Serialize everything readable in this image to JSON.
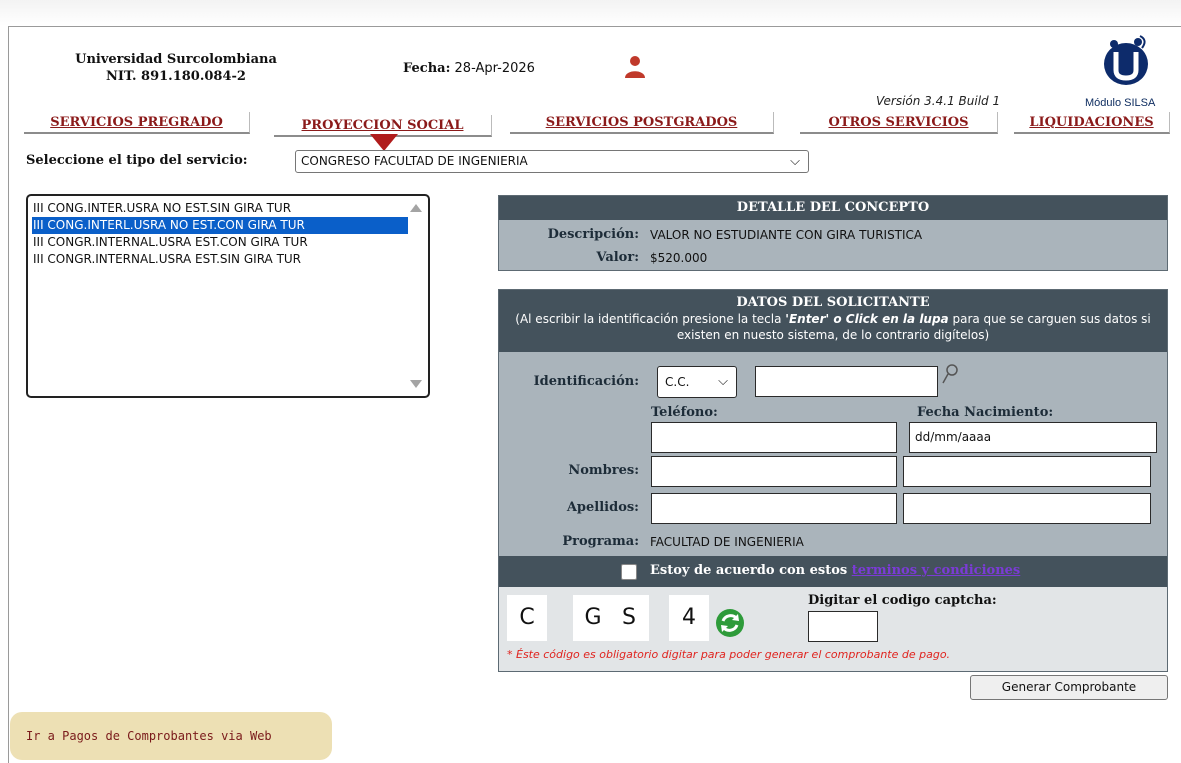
{
  "header": {
    "university": "Universidad Surcolombiana",
    "nit": "NIT. 891.180.084-2",
    "fecha_label": "Fecha:",
    "fecha_value": "28-Apr-2026",
    "version": "Versión 3.4.1 Build 1",
    "module": "Módulo SILSA"
  },
  "tabs": [
    {
      "label": "SERVICIOS PREGRADO",
      "active": false
    },
    {
      "label": "PROYECCION SOCIAL",
      "active": true
    },
    {
      "label": "SERVICIOS POSTGRADOS",
      "active": false
    },
    {
      "label": "OTROS SERVICIOS",
      "active": false
    },
    {
      "label": "LIQUIDACIONES",
      "active": false
    }
  ],
  "service": {
    "label": "Seleccione el tipo del servicio:",
    "selected": "CONGRESO FACULTAD DE INGENIERIA"
  },
  "concept_list": [
    {
      "label": "III CONG.INTER.USRA NO EST.SIN GIRA TUR",
      "selected": false
    },
    {
      "label": "III CONG.INTERL.USRA NO EST.CON GIRA TUR",
      "selected": true
    },
    {
      "label": "III CONGR.INTERNAL.USRA EST.CON GIRA TUR",
      "selected": false
    },
    {
      "label": "III CONGR.INTERNAL.USRA EST.SIN GIRA TUR",
      "selected": false
    }
  ],
  "concept_detail": {
    "title": "DETALLE DEL CONCEPTO",
    "description_label": "Descripción:",
    "description_value": "VALOR NO ESTUDIANTE CON GIRA TURISTICA",
    "value_label": "Valor:",
    "value_value": "$520.000"
  },
  "applicant": {
    "title": "DATOS DEL SOLICITANTE",
    "note_pre": "(Al escribir la identificación presione la tecla ",
    "note_em": "'Enter' o Click en la lupa",
    "note_post": " para que se carguen sus datos si existen en nuesto sistema, de lo contrario digítelos)",
    "id_label": "Identificación:",
    "id_type": "C.C.",
    "id_value": "",
    "phone_label": "Teléfono:",
    "phone_value": "",
    "birth_label": "Fecha Nacimiento:",
    "birth_value": "dd/mm/aaaa",
    "names_label": "Nombres:",
    "surnames_label": "Apellidos:",
    "program_label": "Programa:",
    "program_value": "FACULTAD DE INGENIERIA",
    "terms_text": "Estoy de acuerdo con estos",
    "terms_link": "terminos y condiciones"
  },
  "captcha": {
    "chars": [
      "C",
      "G",
      "S",
      "4"
    ],
    "label": "Digitar el codigo captcha:",
    "note": "* Éste código es obligatorio digitar para poder generar el comprobante de pago."
  },
  "buttons": {
    "generate": "Generar Comprobante",
    "web_payments": "Ir a Pagos de Comprobantes via Web"
  },
  "colors": {
    "tab_text": "#8b1a1a",
    "panel_header": "#44525c",
    "panel_body": "#aab4bb",
    "selection": "#0a5fc9",
    "link": "#7b3bd6",
    "warning": "#e0241f",
    "payments_button": "#ede0b4"
  }
}
